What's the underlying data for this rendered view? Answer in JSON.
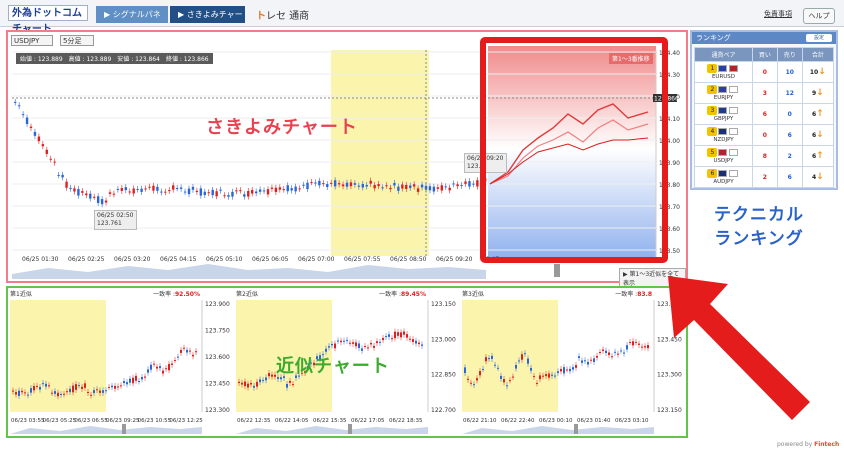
{
  "header": {
    "logo": "外為ドットコム チャート",
    "tabs": [
      {
        "label": "▶ シグナルパネル",
        "active": false
      },
      {
        "label": "▶ さきよみチャート",
        "active": true
      }
    ],
    "brand": {
      "mark": "ト",
      "name": "レセ 通商"
    },
    "disclaimer_link": "免責事項",
    "help_button": "ヘルプ"
  },
  "main_chart": {
    "pair_select": "USDJPY",
    "timeframe_select": "5分足",
    "ohlc": "始値 : 123.889　高値 : 123.889　安値 : 123.864　終値 : 123.866",
    "annotation_label": "さきよみチャート",
    "forecast_badge": "第1〜3番推移",
    "show_all_button": "▶ 第1〜3近似を全て表示",
    "low_marker": {
      "time": "06/25 02:50",
      "price": "123.761"
    },
    "mid_marker": {
      "time": "06/25 09:20",
      "price": "123.8"
    },
    "x_ticks": [
      "06/25 01:30",
      "06/25 02:25",
      "06/25 03:20",
      "06/25 04:15",
      "06/25 05:10",
      "06/25 06:05",
      "06/25 07:00",
      "06/25 07:55",
      "06/25 08:50",
      "06/25 09:20",
      "09:45"
    ],
    "y_ticks": [
      "124.40",
      "124.30",
      "124.20",
      "124.10",
      "124.00",
      "123.90",
      "123.80",
      "123.70",
      "123.60",
      "123.50"
    ],
    "current_price": "123.866",
    "accent_color": "#e41c1c"
  },
  "ranking": {
    "title": "ランキング",
    "settings_button": "設定",
    "columns": [
      "通貨ペア",
      "買い",
      "売り",
      "合計"
    ],
    "rows": [
      {
        "rank": "1",
        "pair": "EURUSD",
        "buy": "0",
        "sell": "10",
        "total": "10",
        "trend": "down"
      },
      {
        "rank": "2",
        "pair": "EURJPY",
        "buy": "3",
        "sell": "12",
        "total": "9",
        "trend": "down"
      },
      {
        "rank": "3",
        "pair": "GBPJPY",
        "buy": "6",
        "sell": "0",
        "total": "6",
        "trend": "up"
      },
      {
        "rank": "4",
        "pair": "NZDJPY",
        "buy": "0",
        "sell": "6",
        "total": "6",
        "trend": "down"
      },
      {
        "rank": "5",
        "pair": "USDJPY",
        "buy": "8",
        "sell": "2",
        "total": "6",
        "trend": "up"
      },
      {
        "rank": "6",
        "pair": "AUDJPY",
        "buy": "2",
        "sell": "6",
        "total": "4",
        "trend": "down"
      }
    ],
    "annotation_label_line1": "テクニカル",
    "annotation_label_line2": "ランキング"
  },
  "similar_charts": {
    "annotation_label": "近似チャート",
    "match_label": "一致率 :",
    "panels": [
      {
        "title": "第1近似",
        "match": "92.50%",
        "y_ticks": [
          "123.900",
          "123.750",
          "123.600",
          "123.450",
          "123.300"
        ],
        "x_ticks": [
          "06/23 03:55",
          "06/23 05:25",
          "06/23 06:55",
          "06/23 09:25",
          "06/23 10:55",
          "06/23 12:25"
        ]
      },
      {
        "title": "第2近似",
        "match": "89.45%",
        "y_ticks": [
          "123.150",
          "123.000",
          "122.850",
          "122.700"
        ],
        "x_ticks": [
          "06/22 12:35",
          "06/22 14:05",
          "06/22 15:35",
          "06/22 17:05",
          "06/22 18:35"
        ]
      },
      {
        "title": "第3近似",
        "match": "83.8",
        "y_ticks": [
          "123.600",
          "123.450",
          "123.300",
          "123.150"
        ],
        "x_ticks": [
          "06/22 21:10",
          "06/22 22:40",
          "06/23 00:10",
          "06/23 01:40",
          "06/23 03:10"
        ]
      }
    ]
  },
  "footer": {
    "prefix": "powered by",
    "brand": "Fintech"
  }
}
